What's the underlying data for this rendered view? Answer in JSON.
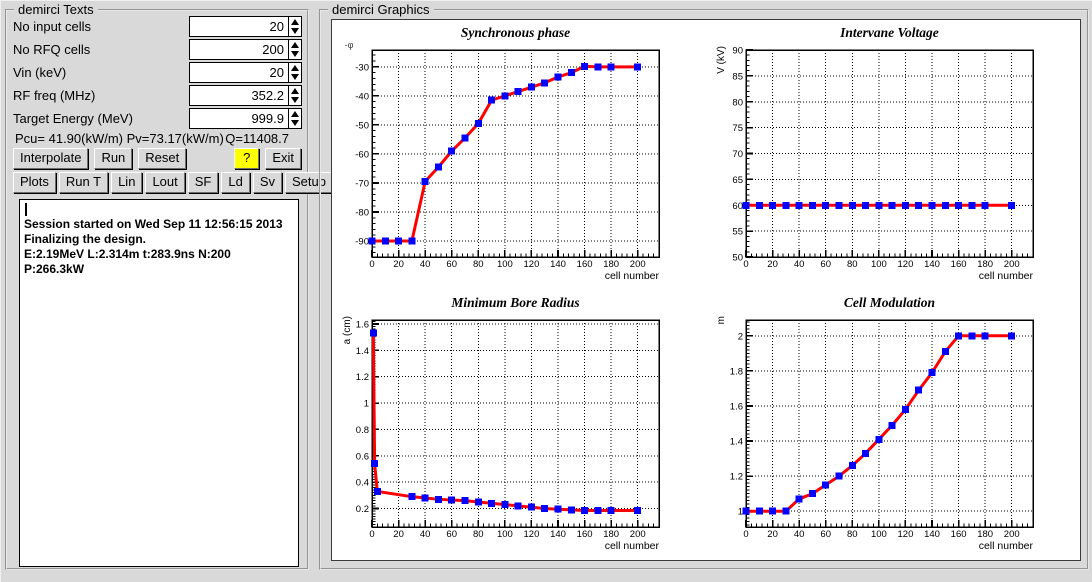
{
  "left_panel": {
    "title": "demirci Texts",
    "fields": [
      {
        "label": "No input cells",
        "value": "20"
      },
      {
        "label": "No RFQ cells",
        "value": "200"
      },
      {
        "label": "Vin (keV)",
        "value": "20"
      },
      {
        "label": "RF freq (MHz)",
        "value": "352.2"
      },
      {
        "label": "Target Energy (MeV)",
        "value": "999.9"
      }
    ],
    "status": {
      "power": "Pcu= 41.90(kW/m) Pv=73.17(kW/m)",
      "q": "Q=11408.7"
    },
    "buttons_row1": [
      "Interpolate",
      "Run",
      "Reset",
      "?",
      "Exit"
    ],
    "buttons_row2": [
      "Plots",
      "Run T",
      "Lin",
      "Lout",
      "SF",
      "Ld",
      "Sv",
      "Setup"
    ],
    "log_lines": [
      "Session started on Wed Sep 11 12:56:15 2013",
      "Finalizing the design.",
      "E:2.19MeV L:2.314m t:283.9ns N:200 P:266.3kW"
    ]
  },
  "right_panel": {
    "title": "demirci Graphics"
  },
  "colors": {
    "line": "#ff0000",
    "marker": "#0000ff",
    "help_button_bg": "#ffff00",
    "window_bg": "#d9d9d9"
  },
  "chart_data": [
    {
      "type": "line",
      "title": "Synchronous phase",
      "xlabel": "cell number",
      "ylabel": "-φ",
      "ylabel_rotate": false,
      "x": [
        0,
        10,
        20,
        30,
        40,
        50,
        60,
        70,
        80,
        90,
        100,
        110,
        120,
        130,
        140,
        150,
        160,
        170,
        180,
        200
      ],
      "y": [
        -90,
        -90,
        -90,
        -90,
        -69.5,
        -64.5,
        -59,
        -54.5,
        -49.5,
        -41.5,
        -40,
        -38.5,
        -37,
        -35.5,
        -33.5,
        -32,
        -29.8,
        -30,
        -30,
        -30
      ],
      "xlim": [
        0,
        216
      ],
      "ylim": [
        -95.5,
        -24.2
      ],
      "xticks": [
        0,
        20,
        40,
        60,
        80,
        100,
        120,
        140,
        160,
        180,
        200
      ],
      "yticks": [
        -90,
        -80,
        -70,
        -60,
        -50,
        -40,
        -30
      ],
      "ytick_labels": [
        "-90",
        "-80",
        "-70",
        "-60",
        "-50",
        "-40",
        "-30"
      ],
      "xminor": 4,
      "yminor": 2,
      "grid": true,
      "legend": "none"
    },
    {
      "type": "line",
      "title": "Intervane Voltage",
      "xlabel": "cell number",
      "ylabel": "V (kV)",
      "ylabel_rotate": true,
      "x": [
        0,
        10,
        20,
        30,
        40,
        50,
        60,
        70,
        80,
        90,
        100,
        110,
        120,
        130,
        140,
        150,
        160,
        170,
        180,
        200
      ],
      "y": [
        60,
        60,
        60,
        60,
        60,
        60,
        60,
        60,
        60,
        60,
        60,
        60,
        60,
        60,
        60,
        60,
        60,
        60,
        60,
        60
      ],
      "xlim": [
        0,
        216
      ],
      "ylim": [
        50,
        90
      ],
      "xticks": [
        0,
        20,
        40,
        60,
        80,
        100,
        120,
        140,
        160,
        180,
        200
      ],
      "yticks": [
        50,
        55,
        60,
        65,
        70,
        75,
        80,
        85,
        90
      ],
      "ytick_labels": [
        "50",
        "55",
        "60",
        "65",
        "70",
        "75",
        "80",
        "85",
        "90"
      ],
      "xminor": 4,
      "yminor": 1,
      "grid": true,
      "legend": "none"
    },
    {
      "type": "line",
      "title": "Minimum Bore Radius",
      "xlabel": "cell number",
      "ylabel": "a (cm)",
      "ylabel_rotate": true,
      "x": [
        1,
        2,
        4,
        30,
        40,
        50,
        60,
        70,
        80,
        90,
        100,
        110,
        120,
        130,
        140,
        150,
        160,
        170,
        180,
        200
      ],
      "y": [
        1.53,
        0.54,
        0.33,
        0.29,
        0.28,
        0.27,
        0.265,
        0.26,
        0.25,
        0.24,
        0.23,
        0.22,
        0.21,
        0.2,
        0.195,
        0.19,
        0.185,
        0.185,
        0.185,
        0.185
      ],
      "xlim": [
        0,
        216
      ],
      "ylim": [
        0.06,
        1.63
      ],
      "xticks": [
        0,
        20,
        40,
        60,
        80,
        100,
        120,
        140,
        160,
        180,
        200
      ],
      "yticks": [
        0.2,
        0.4,
        0.6,
        0.8,
        1,
        1.2,
        1.4,
        1.6
      ],
      "ytick_labels": [
        "0.2",
        "0.4",
        "0.6",
        "0.8",
        "1",
        "1.2",
        "1.4",
        "1.6"
      ],
      "xminor": 4,
      "yminor": 0.02,
      "grid": true,
      "legend": "none"
    },
    {
      "type": "line",
      "title": "Cell Modulation",
      "xlabel": "cell number",
      "ylabel": "m",
      "ylabel_rotate": true,
      "x": [
        0,
        10,
        20,
        30,
        40,
        50,
        60,
        70,
        80,
        90,
        100,
        110,
        120,
        130,
        140,
        150,
        160,
        170,
        180,
        200
      ],
      "y": [
        1,
        1,
        1,
        1,
        1.07,
        1.1,
        1.15,
        1.2,
        1.26,
        1.33,
        1.41,
        1.49,
        1.58,
        1.69,
        1.79,
        1.91,
        2,
        2,
        2,
        2
      ],
      "xlim": [
        0,
        216
      ],
      "ylim": [
        0.91,
        2.09
      ],
      "xticks": [
        0,
        20,
        40,
        60,
        80,
        100,
        120,
        140,
        160,
        180,
        200
      ],
      "yticks": [
        1,
        1.2,
        1.4,
        1.6,
        1.8,
        2
      ],
      "ytick_labels": [
        "1",
        "1.2",
        "1.4",
        "1.6",
        "1.8",
        "2"
      ],
      "xminor": 4,
      "yminor": 0.02,
      "grid": true,
      "legend": "none"
    }
  ]
}
